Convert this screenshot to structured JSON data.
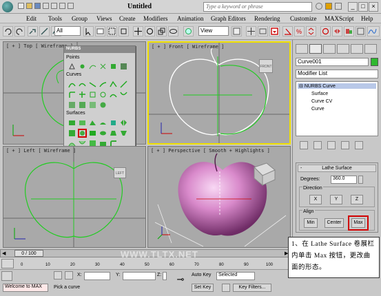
{
  "window": {
    "title": "Untitled",
    "search_placeholder": "Type a keyword or phrase"
  },
  "menu": [
    "Edit",
    "Tools",
    "Group",
    "Views",
    "Create",
    "Modifiers",
    "Animation",
    "Graph Editors",
    "Rendering",
    "Customize",
    "MAXScript",
    "Help"
  ],
  "toolbar": {
    "selection_filter": "All",
    "ref_coord": "View"
  },
  "viewports": {
    "top": "[ + ] Top [ Wireframe ]",
    "front": "[ + ] Front [ Wireframe ]",
    "left": "[ + ] Left [ Wireframe ]",
    "perspective": "[ + ] Perspective [ Smooth + Highlights ]",
    "front_cube": "FRONT",
    "left_cube": "LEFT"
  },
  "nurbs_panel": {
    "title": "NURBS",
    "points": "Points",
    "curves": "Curves",
    "surfaces": "Surfaces"
  },
  "command_panel": {
    "object_name": "Curve001",
    "object_color": "#2eb82e",
    "modifier_list": "Modifier List",
    "stack": {
      "root": "NURBS Curve",
      "sub": [
        "Surface",
        "Curve CV",
        "Curve"
      ]
    },
    "rollout": {
      "title": "Lathe Surface",
      "degrees_label": "Degrees:",
      "degrees_value": "360.0",
      "direction_label": "Direction",
      "dir_x": "X",
      "dir_y": "Y",
      "dir_z": "Z",
      "align_label": "Align",
      "min": "Min",
      "center": "Center",
      "max": "Max"
    }
  },
  "timeline": {
    "frame": "0 / 100",
    "ticks": [
      "0",
      "10",
      "20",
      "30",
      "40",
      "50",
      "60",
      "70",
      "80",
      "90",
      "100"
    ]
  },
  "status": {
    "welcome": "Welcome to MAX",
    "prompt": "Pick a curve",
    "x_label": "X:",
    "y_label": "Y:",
    "z_label": "Z:",
    "auto_key": "Auto Key",
    "set_key": "Set Key",
    "selected": "Selected",
    "key_filters": "Key Filters..."
  },
  "watermark": "WWW.TLTX.NET",
  "callout": "1、在 Lathe Surface 卷展栏内单击 Max 按钮，更改曲面的形态。"
}
